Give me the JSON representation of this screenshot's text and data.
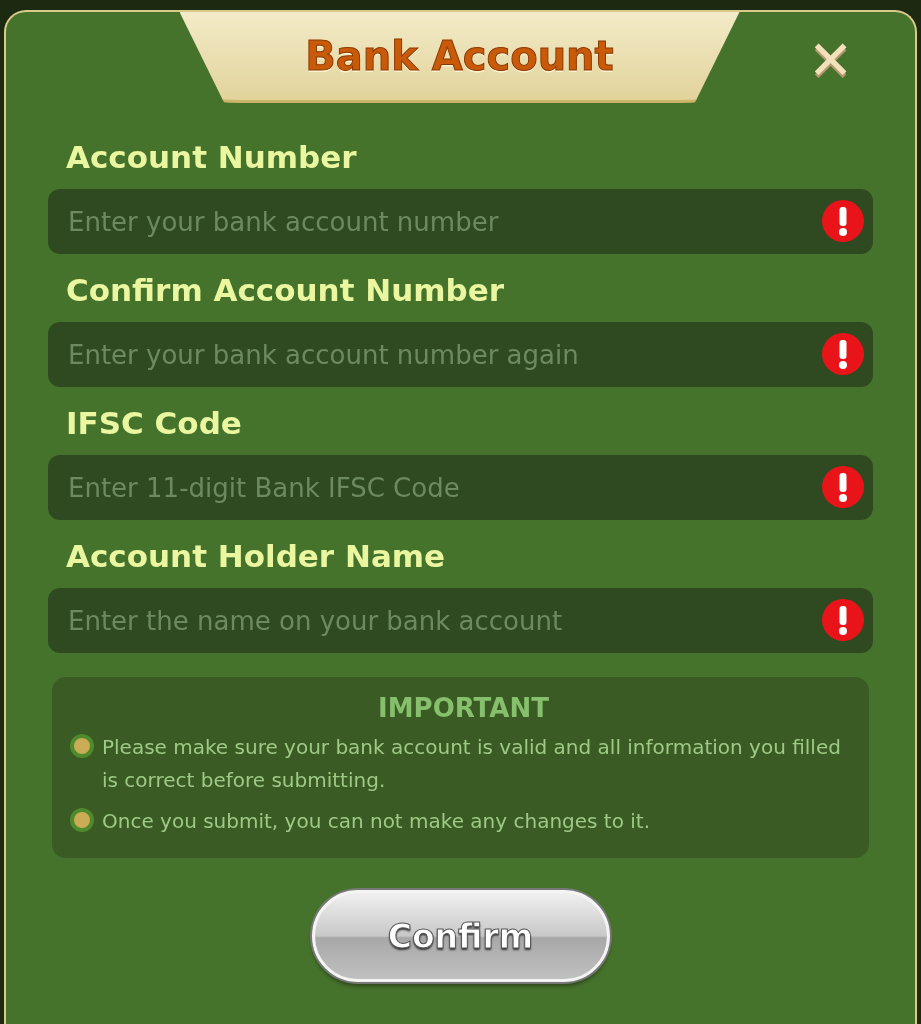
{
  "dialog": {
    "title": "Bank Account",
    "close_label": "✕"
  },
  "fields": [
    {
      "label": "Account Number",
      "placeholder": "Enter your bank account number",
      "error": true
    },
    {
      "label": "Confirm Account Number",
      "placeholder": "Enter your bank account number again",
      "error": true
    },
    {
      "label": "IFSC Code",
      "placeholder": "Enter 11-digit Bank IFSC Code",
      "error": true
    },
    {
      "label": "Account Holder Name",
      "placeholder": "Enter the name on your bank account",
      "error": true
    }
  ],
  "notice": {
    "title": "IMPORTANT",
    "items": [
      "Please make sure your bank account is valid and all information you filled is correct before submitting.",
      "Once you submit, you can not make any changes to it."
    ]
  },
  "buttons": [
    "Confirm"
  ]
}
